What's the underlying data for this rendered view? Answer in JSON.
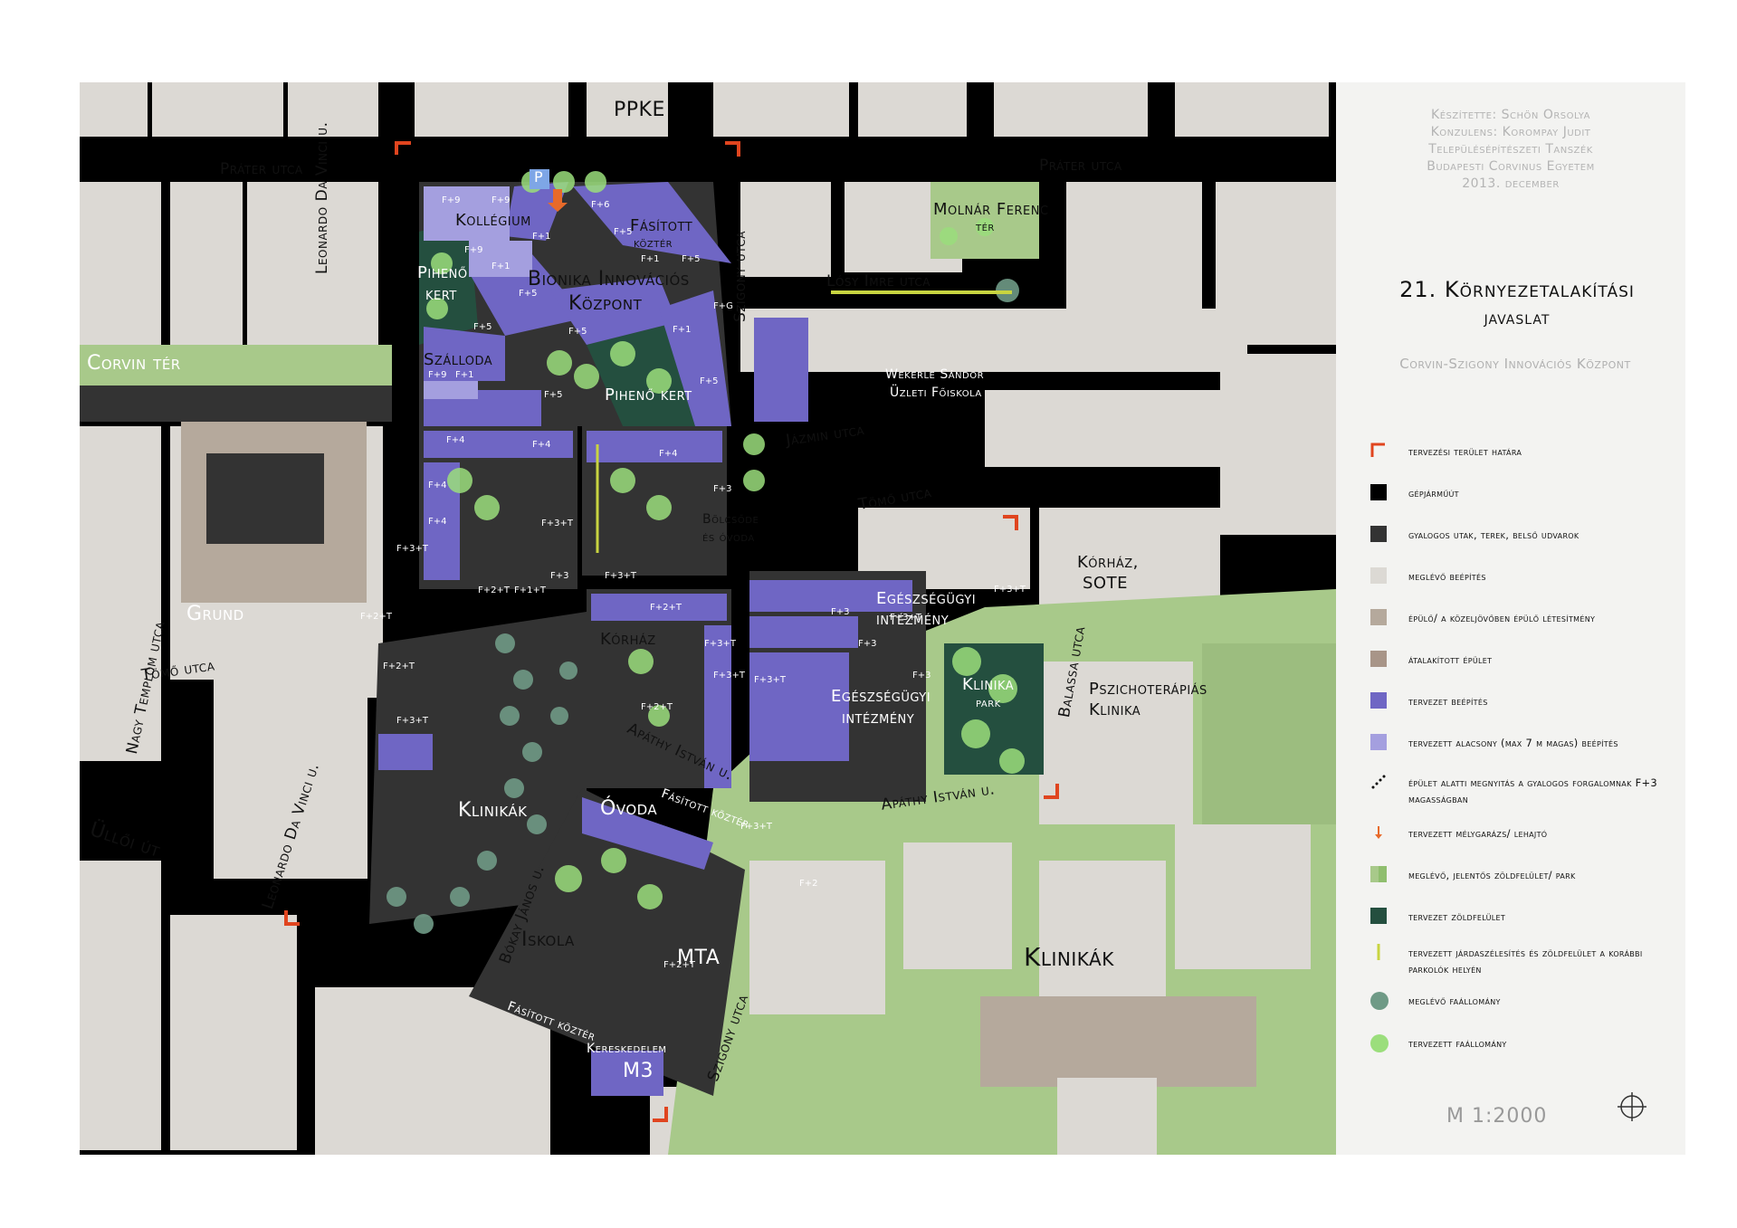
{
  "map": {
    "labels": {
      "prater_w": "Práter utca",
      "prater_e": "Práter utca",
      "leonardo_n": "Leonardo Da Vinci u.",
      "leonardo_s": "Leonardo Da Vinci u.",
      "szigony_n": "Szigony utca",
      "szigony_s": "Szigony utca",
      "losy": "Lósy Imre utca",
      "jazmin": "Jázmin utca",
      "tomo_e": "Tömő utca",
      "tomo_w": "Tömő utca",
      "balassa": "Balassa utca",
      "apathy_1": "Apáthy István u.",
      "apathy_2": "Apáthy István u.",
      "ulloi": "Üllői út",
      "nagytemplom": "Nagy Templom utca",
      "bokay": "Bókay János u.",
      "ppke": "PPKE",
      "kollegium": "Kollégium",
      "fasitott_1": "Fásított",
      "fasitott_1b": "köztér",
      "molnar_1": "Molnár Ferenc",
      "molnar_2": "tér",
      "bionika_1": "Bionika Innovációs",
      "bionika_2": "Központ",
      "piheno_1": "Pihenő",
      "piheno_1b": "kert",
      "szalloda": "Szálloda",
      "piheno_2": "Pihenő kert",
      "wekerle_1": "Wekerle Sándor",
      "wekerle_2": "Üzleti Főiskola",
      "corvin": "Corvin tér",
      "bolcsode_1": "Bölcsőde",
      "bolcsode_2": "és óvoda",
      "korhaz_sote_1": "Kórház,",
      "korhaz_sote_2": "SOTE",
      "grund": "Grund",
      "egeszseg_1a": "Egészségügyi",
      "egeszseg_1b": "intézmény",
      "korhaz": "Kórház",
      "egeszseg_2a": "Egészségügyi",
      "egeszseg_2b": "intézmény",
      "klinika_park_1": "Klinika",
      "klinika_park_2": "park",
      "pszicho_1": "Pszichoterápiás",
      "pszicho_2": "Klinika",
      "klinikak_w": "Klinikák",
      "ovoda": "Óvoda",
      "fasitott_2": "Fásított köztér",
      "iskola": "Iskola",
      "mta": "MTA",
      "fasitott_3": "Fásított köztér",
      "kereskedelem": "Kereskedelem",
      "m3": "M3",
      "klinikak_big": "Klinikák",
      "parking": "P"
    },
    "floors": [
      "F+9",
      "F+9",
      "F+6",
      "F+1",
      "F+9",
      "F+1",
      "F+5",
      "F+1",
      "F+5",
      "F+5",
      "F+G",
      "F+5",
      "F+5",
      "F+1",
      "F+5",
      "F+9",
      "F+1",
      "F+5",
      "F+4",
      "F+4",
      "F+4",
      "F+4",
      "F+4",
      "F+3+T",
      "F+2+T",
      "F+1+T",
      "F+3",
      "F+3",
      "F+3+T",
      "F+3+T",
      "F+2+T",
      "F+3+T",
      "F+3",
      "F+3+T",
      "F+2+T",
      "F+2+T",
      "F+3+T",
      "F+3",
      "F+3",
      "F+3+T",
      "F+3+T",
      "F+2+T",
      "F+3+T",
      "F+2+T",
      "F+3+T",
      "F+2"
    ]
  },
  "panel": {
    "credit_1": "Készítette: Schön Orsolya",
    "credit_2": "Konzulens: Korompay Judit",
    "credit_3": "Településépítészeti Tanszék",
    "credit_4": "Budapesti Corvinus Egyetem",
    "credit_5": "2013. december",
    "title_1": "21. Környezetalakítási",
    "title_2": "javaslat",
    "subtitle": "Corvin-Szigony Innovációs Központ",
    "legend": [
      {
        "label": "tervezési terület határa",
        "color": "#e0451f"
      },
      {
        "label": "gépjárműút",
        "color": "#000000"
      },
      {
        "label": "gyalogos utak, terek, belső udvarok",
        "color": "#333333"
      },
      {
        "label": "meglévő beépítés",
        "color": "#dcd9d4"
      },
      {
        "label": "épülő/ a közeljövőben épülő létesítmény",
        "color": "#b5a99c"
      },
      {
        "label": "átalakított épület",
        "color": "#a89588"
      },
      {
        "label": "tervezet beépítés",
        "color": "#6f66c4"
      },
      {
        "label": "tervezett alacsony (max 7 m magas) beépítés",
        "color": "#a49fdf"
      },
      {
        "label": "épület alatti megnyitás a gyalogos forgalomnak F+3 magasságban",
        "color": "#000000"
      },
      {
        "label": "tervezett mélygarázs/ lehajtó",
        "color": "#e86a2a"
      },
      {
        "label": "meglévő, jelentős zöldfelület/ park",
        "color": "#a8c98a"
      },
      {
        "label": "tervezet zöldfelület",
        "color": "#244f3f"
      },
      {
        "label": "tervezett járdaszélesítés és zöldfelület a korábbi parkolók helyén",
        "color": "#c8d440"
      },
      {
        "label": "meglévő faállomány",
        "color": "#6f9a86"
      },
      {
        "label": "tervezett faállomány",
        "color": "#9bde7c"
      }
    ],
    "scale": "M 1:2000"
  }
}
